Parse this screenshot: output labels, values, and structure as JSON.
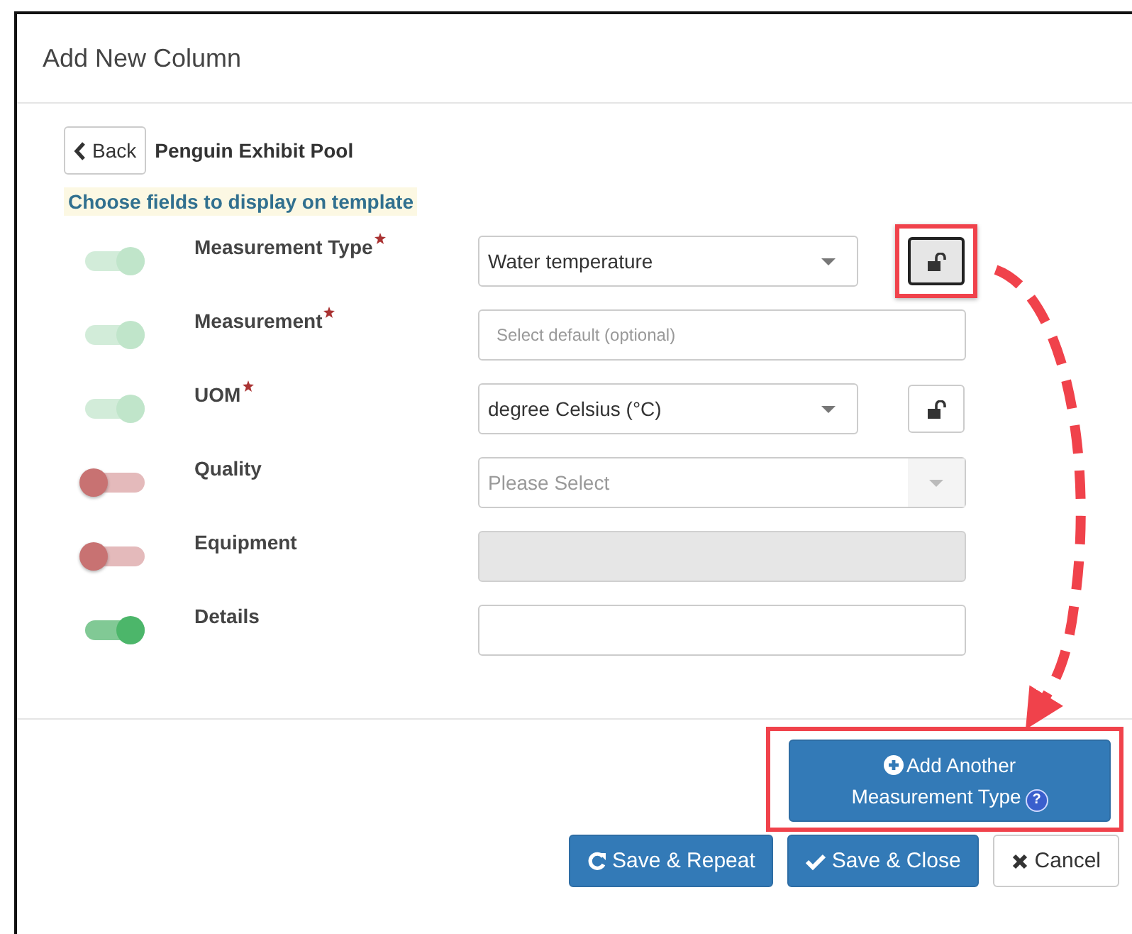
{
  "window": {
    "title": "Add New Column"
  },
  "back_button": {
    "label": "Back"
  },
  "location": "Penguin Exhibit Pool",
  "section_label": "Choose fields to display on template",
  "fields": [
    {
      "label": "Measurement Type",
      "required": true,
      "on": true,
      "toggle_disabled": true,
      "kind": "select",
      "value": "Water temperature",
      "disabled": false,
      "lock": {
        "highlighted": true
      }
    },
    {
      "label": "Measurement",
      "required": true,
      "on": true,
      "toggle_disabled": true,
      "kind": "input",
      "placeholder": "Select default (optional)",
      "disabled": false
    },
    {
      "label": "UOM",
      "required": true,
      "on": true,
      "toggle_disabled": true,
      "kind": "select",
      "value": "degree Celsius (°C)",
      "disabled": false,
      "lock": {
        "highlighted": false
      }
    },
    {
      "label": "Quality",
      "required": false,
      "on": false,
      "toggle_disabled": false,
      "kind": "select",
      "placeholder": "Please Select",
      "disabled": true
    },
    {
      "label": "Equipment",
      "required": false,
      "on": false,
      "toggle_disabled": false,
      "kind": "input",
      "disabled": true
    },
    {
      "label": "Details",
      "required": false,
      "on": true,
      "toggle_disabled": false,
      "kind": "input",
      "disabled": false
    }
  ],
  "add_button": {
    "label": "Add Another Measurement Type",
    "help": "?",
    "highlighted": true
  },
  "buttons": [
    {
      "label": "Save & Repeat",
      "kind": "primary"
    },
    {
      "label": "Save & Close",
      "kind": "primary"
    },
    {
      "label": "Cancel",
      "kind": "default"
    }
  ]
}
